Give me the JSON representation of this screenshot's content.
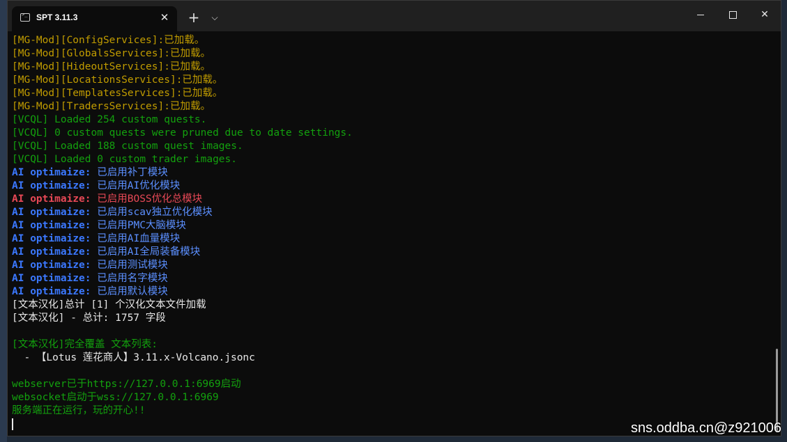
{
  "window": {
    "tab_title": "SPT 3.11.3",
    "tab_close_glyph": "✕",
    "new_tab_glyph": "+",
    "dropdown_glyph": "⌵",
    "close_glyph": "✕"
  },
  "terminal": {
    "lines": [
      {
        "style": "yellow",
        "text": "[MG-Mod][ConfigServices]:已加载。"
      },
      {
        "style": "yellow",
        "text": "[MG-Mod][GlobalsServices]:已加载。"
      },
      {
        "style": "yellow",
        "text": "[MG-Mod][HideoutServices]:已加载。"
      },
      {
        "style": "yellow",
        "text": "[MG-Mod][LocationsServices]:已加载。"
      },
      {
        "style": "yellow",
        "text": "[MG-Mod][TemplatesServices]:已加载。"
      },
      {
        "style": "yellow",
        "text": "[MG-Mod][TradersServices]:已加载。"
      },
      {
        "style": "green",
        "text": "[VCQL] Loaded 254 custom quests."
      },
      {
        "style": "green",
        "text": "[VCQL] 0 custom quests were pruned due to date settings."
      },
      {
        "style": "green",
        "text": "[VCQL] Loaded 188 custom quest images."
      },
      {
        "style": "green",
        "text": "[VCQL] Loaded 0 custom trader images."
      },
      {
        "style": "blue",
        "prefix": "AI optimaize:",
        "text": " 已启用补丁模块"
      },
      {
        "style": "blue",
        "prefix": "AI optimaize:",
        "text": " 已启用AI优化模块"
      },
      {
        "style": "red",
        "prefix": "AI optimaize:",
        "text": " 已启用BOSS优化总模块"
      },
      {
        "style": "blue",
        "prefix": "AI optimaize:",
        "text": " 已启用scav独立优化模块"
      },
      {
        "style": "blue",
        "prefix": "AI optimaize:",
        "text": " 已启用PMC大脑模块"
      },
      {
        "style": "blue",
        "prefix": "AI optimaize:",
        "text": " 已启用AI血量模块"
      },
      {
        "style": "blue",
        "prefix": "AI optimaize:",
        "text": " 已启用AI全局装备模块"
      },
      {
        "style": "blue",
        "prefix": "AI optimaize:",
        "text": " 已启用测试模块"
      },
      {
        "style": "blue",
        "prefix": "AI optimaize:",
        "text": " 已启用名字模块"
      },
      {
        "style": "blue",
        "prefix": "AI optimaize:",
        "text": " 已启用默认模块"
      },
      {
        "style": "white",
        "text": "[文本汉化]总计 [1] 个汉化文本文件加载"
      },
      {
        "style": "white",
        "text": "[文本汉化] - 总计: 1757 字段"
      },
      {
        "style": "white",
        "text": ""
      },
      {
        "style": "green",
        "text": "[文本汉化]完全覆盖 文本列表:"
      },
      {
        "style": "white",
        "text": "  - 【Lotus 莲花商人】3.11.x-Volcano.jsonc"
      },
      {
        "style": "white",
        "text": ""
      },
      {
        "style": "green",
        "text": "webserver已于https://127.0.0.1:6969启动"
      },
      {
        "style": "green",
        "text": "websocket启动于wss://127.0.0.1:6969"
      },
      {
        "style": "green",
        "text": "服务端正在运行，玩的开心!!"
      }
    ]
  },
  "watermark": "sns.oddba.cn@z921006"
}
